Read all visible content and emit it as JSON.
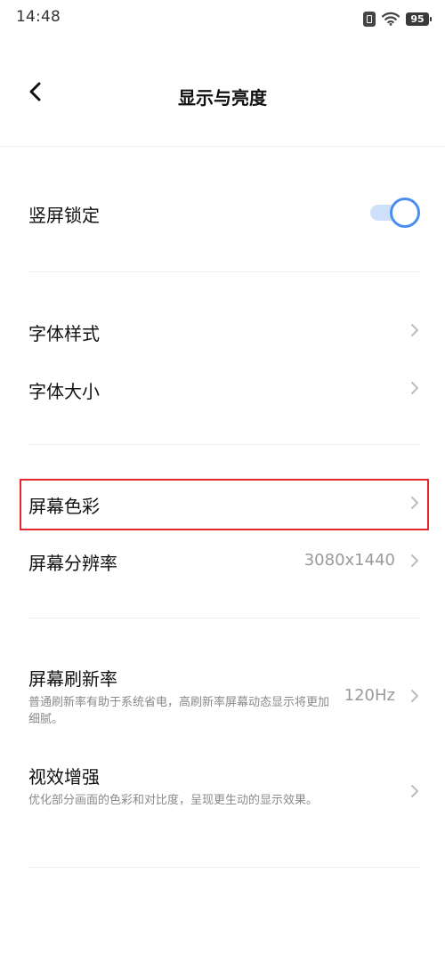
{
  "status_bar": {
    "time": "14:48",
    "battery": "95"
  },
  "header": {
    "title": "显示与亮度"
  },
  "items": {
    "portrait_lock": {
      "label": "竖屏锁定",
      "toggle_on": true
    },
    "font_style": {
      "label": "字体样式"
    },
    "font_size": {
      "label": "字体大小"
    },
    "screen_color": {
      "label": "屏幕色彩"
    },
    "screen_resolution": {
      "label": "屏幕分辨率",
      "value": "3080x1440"
    },
    "refresh_rate": {
      "label": "屏幕刷新率",
      "description": "普通刷新率有助于系统省电，高刷新率屏幕动态显示将更加细腻。",
      "value": "120Hz"
    },
    "visual_enhance": {
      "label": "视效增强",
      "description": "优化部分画面的色彩和对比度，呈现更生动的显示效果。"
    }
  },
  "colors": {
    "accent": "#4a8ff0",
    "highlight": "#e0282e"
  }
}
